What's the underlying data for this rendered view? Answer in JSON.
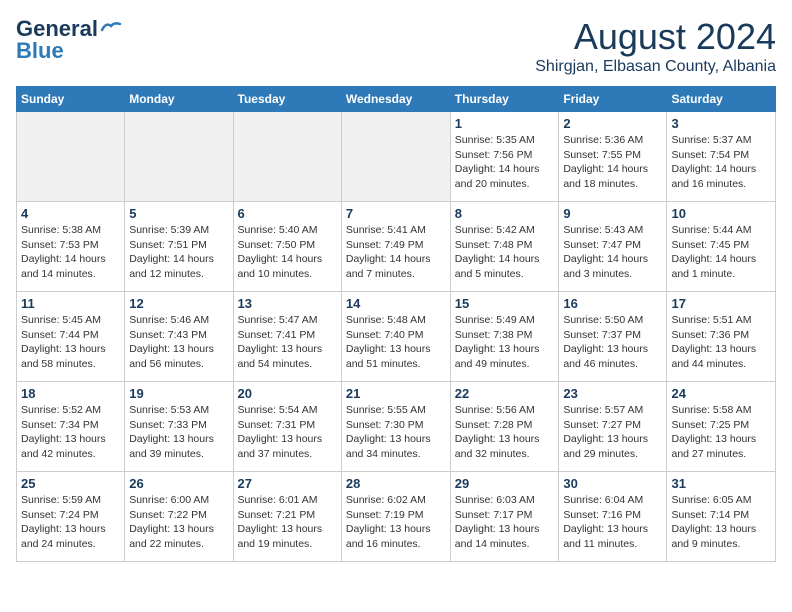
{
  "header": {
    "logo_line1": "General",
    "logo_line2": "Blue",
    "month_year": "August 2024",
    "location": "Shirgjan, Elbasan County, Albania"
  },
  "weekdays": [
    "Sunday",
    "Monday",
    "Tuesday",
    "Wednesday",
    "Thursday",
    "Friday",
    "Saturday"
  ],
  "weeks": [
    [
      {
        "day": "",
        "detail": ""
      },
      {
        "day": "",
        "detail": ""
      },
      {
        "day": "",
        "detail": ""
      },
      {
        "day": "",
        "detail": ""
      },
      {
        "day": "1",
        "detail": "Sunrise: 5:35 AM\nSunset: 7:56 PM\nDaylight: 14 hours\nand 20 minutes."
      },
      {
        "day": "2",
        "detail": "Sunrise: 5:36 AM\nSunset: 7:55 PM\nDaylight: 14 hours\nand 18 minutes."
      },
      {
        "day": "3",
        "detail": "Sunrise: 5:37 AM\nSunset: 7:54 PM\nDaylight: 14 hours\nand 16 minutes."
      }
    ],
    [
      {
        "day": "4",
        "detail": "Sunrise: 5:38 AM\nSunset: 7:53 PM\nDaylight: 14 hours\nand 14 minutes."
      },
      {
        "day": "5",
        "detail": "Sunrise: 5:39 AM\nSunset: 7:51 PM\nDaylight: 14 hours\nand 12 minutes."
      },
      {
        "day": "6",
        "detail": "Sunrise: 5:40 AM\nSunset: 7:50 PM\nDaylight: 14 hours\nand 10 minutes."
      },
      {
        "day": "7",
        "detail": "Sunrise: 5:41 AM\nSunset: 7:49 PM\nDaylight: 14 hours\nand 7 minutes."
      },
      {
        "day": "8",
        "detail": "Sunrise: 5:42 AM\nSunset: 7:48 PM\nDaylight: 14 hours\nand 5 minutes."
      },
      {
        "day": "9",
        "detail": "Sunrise: 5:43 AM\nSunset: 7:47 PM\nDaylight: 14 hours\nand 3 minutes."
      },
      {
        "day": "10",
        "detail": "Sunrise: 5:44 AM\nSunset: 7:45 PM\nDaylight: 14 hours\nand 1 minute."
      }
    ],
    [
      {
        "day": "11",
        "detail": "Sunrise: 5:45 AM\nSunset: 7:44 PM\nDaylight: 13 hours\nand 58 minutes."
      },
      {
        "day": "12",
        "detail": "Sunrise: 5:46 AM\nSunset: 7:43 PM\nDaylight: 13 hours\nand 56 minutes."
      },
      {
        "day": "13",
        "detail": "Sunrise: 5:47 AM\nSunset: 7:41 PM\nDaylight: 13 hours\nand 54 minutes."
      },
      {
        "day": "14",
        "detail": "Sunrise: 5:48 AM\nSunset: 7:40 PM\nDaylight: 13 hours\nand 51 minutes."
      },
      {
        "day": "15",
        "detail": "Sunrise: 5:49 AM\nSunset: 7:38 PM\nDaylight: 13 hours\nand 49 minutes."
      },
      {
        "day": "16",
        "detail": "Sunrise: 5:50 AM\nSunset: 7:37 PM\nDaylight: 13 hours\nand 46 minutes."
      },
      {
        "day": "17",
        "detail": "Sunrise: 5:51 AM\nSunset: 7:36 PM\nDaylight: 13 hours\nand 44 minutes."
      }
    ],
    [
      {
        "day": "18",
        "detail": "Sunrise: 5:52 AM\nSunset: 7:34 PM\nDaylight: 13 hours\nand 42 minutes."
      },
      {
        "day": "19",
        "detail": "Sunrise: 5:53 AM\nSunset: 7:33 PM\nDaylight: 13 hours\nand 39 minutes."
      },
      {
        "day": "20",
        "detail": "Sunrise: 5:54 AM\nSunset: 7:31 PM\nDaylight: 13 hours\nand 37 minutes."
      },
      {
        "day": "21",
        "detail": "Sunrise: 5:55 AM\nSunset: 7:30 PM\nDaylight: 13 hours\nand 34 minutes."
      },
      {
        "day": "22",
        "detail": "Sunrise: 5:56 AM\nSunset: 7:28 PM\nDaylight: 13 hours\nand 32 minutes."
      },
      {
        "day": "23",
        "detail": "Sunrise: 5:57 AM\nSunset: 7:27 PM\nDaylight: 13 hours\nand 29 minutes."
      },
      {
        "day": "24",
        "detail": "Sunrise: 5:58 AM\nSunset: 7:25 PM\nDaylight: 13 hours\nand 27 minutes."
      }
    ],
    [
      {
        "day": "25",
        "detail": "Sunrise: 5:59 AM\nSunset: 7:24 PM\nDaylight: 13 hours\nand 24 minutes."
      },
      {
        "day": "26",
        "detail": "Sunrise: 6:00 AM\nSunset: 7:22 PM\nDaylight: 13 hours\nand 22 minutes."
      },
      {
        "day": "27",
        "detail": "Sunrise: 6:01 AM\nSunset: 7:21 PM\nDaylight: 13 hours\nand 19 minutes."
      },
      {
        "day": "28",
        "detail": "Sunrise: 6:02 AM\nSunset: 7:19 PM\nDaylight: 13 hours\nand 16 minutes."
      },
      {
        "day": "29",
        "detail": "Sunrise: 6:03 AM\nSunset: 7:17 PM\nDaylight: 13 hours\nand 14 minutes."
      },
      {
        "day": "30",
        "detail": "Sunrise: 6:04 AM\nSunset: 7:16 PM\nDaylight: 13 hours\nand 11 minutes."
      },
      {
        "day": "31",
        "detail": "Sunrise: 6:05 AM\nSunset: 7:14 PM\nDaylight: 13 hours\nand 9 minutes."
      }
    ]
  ]
}
